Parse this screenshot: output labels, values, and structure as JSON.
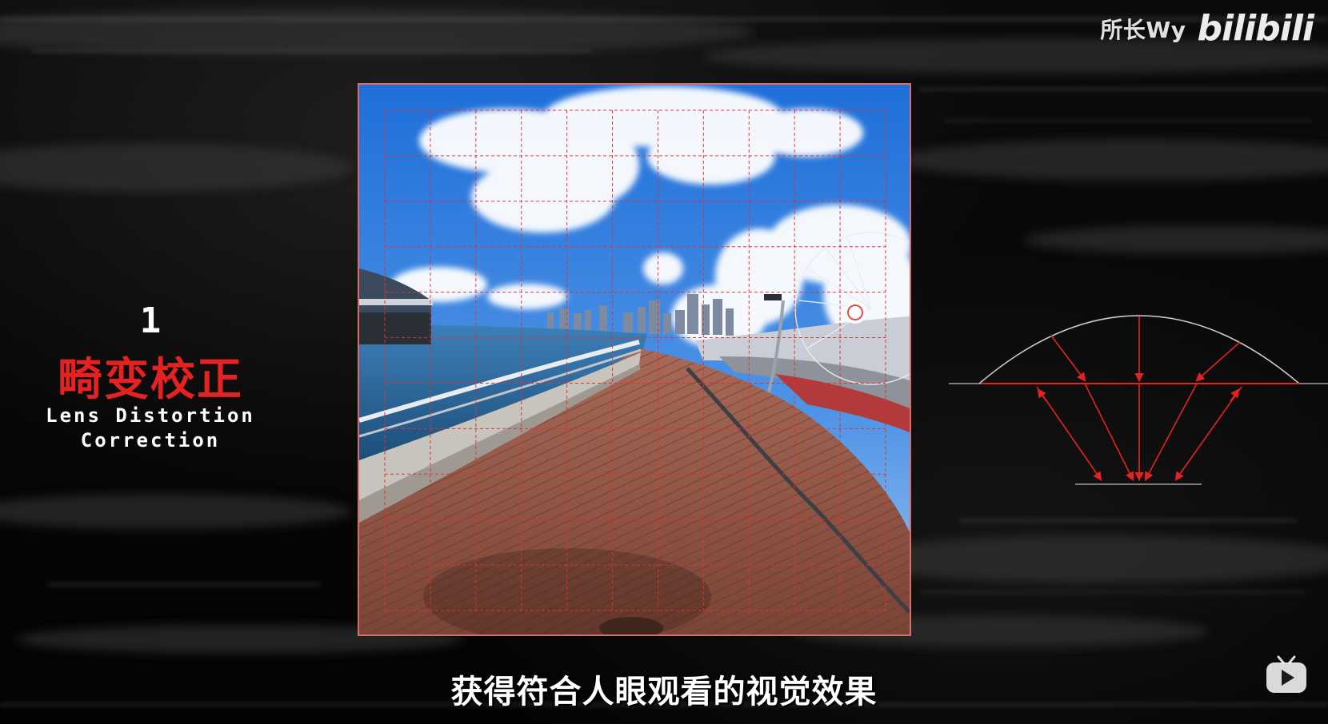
{
  "watermark": {
    "author": "所长Wy",
    "logo_text": "bilibili"
  },
  "left_panel": {
    "step_number": "1",
    "title_cn": "畸变校正",
    "title_en_line1": "Lens Distortion",
    "title_en_line2": "Correction"
  },
  "subtitle": "获得符合人眼观看的视觉效果",
  "colors": {
    "accent_red": "#e52222",
    "grid_red": "#e03030",
    "frame_border": "#d96b6b"
  },
  "icons": {
    "player": "tv-play-icon"
  }
}
